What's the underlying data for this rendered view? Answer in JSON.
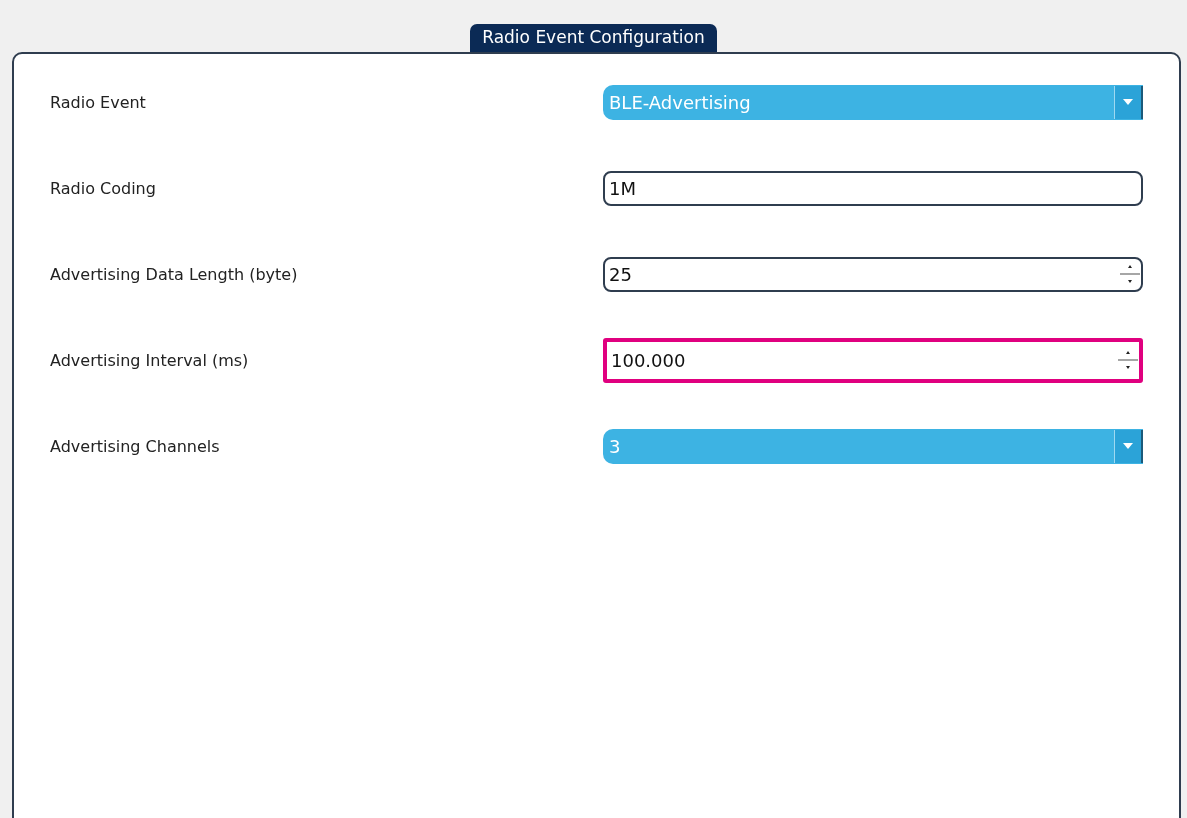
{
  "panel": {
    "title": "Radio Event Configuration"
  },
  "fields": [
    {
      "label": "Radio Event",
      "kind": "dropdown",
      "value": "BLE-Advertising",
      "highlighted": false
    },
    {
      "label": "Radio Coding",
      "kind": "text",
      "value": "1M",
      "highlighted": false
    },
    {
      "label": "Advertising Data Length (byte)",
      "kind": "spinner",
      "value": "25",
      "highlighted": false
    },
    {
      "label": "Advertising Interval (ms)",
      "kind": "spinner",
      "value": "100.000",
      "highlighted": true
    },
    {
      "label": "Advertising Channels",
      "kind": "dropdown",
      "value": "3",
      "highlighted": false
    }
  ]
}
